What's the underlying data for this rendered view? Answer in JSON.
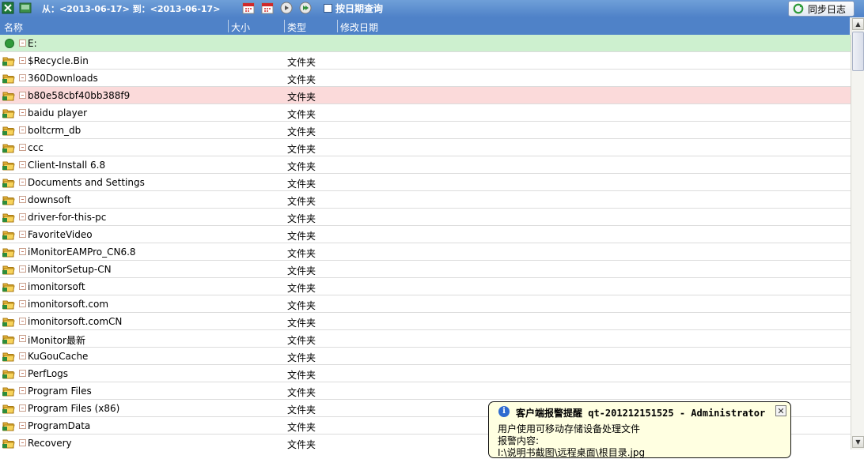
{
  "toolbar": {
    "date_range_text": "从：<2013-06-17> 到：<2013-06-17>",
    "date_query_label": "按日期查询",
    "sync_log_label": "同步日志"
  },
  "columns": [
    "名称",
    "大小",
    "类型",
    "修改日期"
  ],
  "drive": {
    "label": "E:"
  },
  "rows": [
    {
      "name": "$Recycle.Bin",
      "type": "文件夹"
    },
    {
      "name": "360Downloads",
      "type": "文件夹"
    },
    {
      "name": "b80e58cbf40bb388f9",
      "type": "文件夹"
    },
    {
      "name": "baidu player",
      "type": "文件夹"
    },
    {
      "name": "boltcrm_db",
      "type": "文件夹"
    },
    {
      "name": "ccc",
      "type": "文件夹"
    },
    {
      "name": "Client-Install 6.8",
      "type": "文件夹"
    },
    {
      "name": "Documents and Settings",
      "type": "文件夹"
    },
    {
      "name": "downsoft",
      "type": "文件夹"
    },
    {
      "name": "driver-for-this-pc",
      "type": "文件夹"
    },
    {
      "name": "FavoriteVideo",
      "type": "文件夹"
    },
    {
      "name": "iMonitorEAMPro_CN6.8",
      "type": "文件夹"
    },
    {
      "name": "iMonitorSetup-CN",
      "type": "文件夹"
    },
    {
      "name": "imonitorsoft",
      "type": "文件夹"
    },
    {
      "name": "imonitorsoft.com",
      "type": "文件夹"
    },
    {
      "name": "imonitorsoft.comCN",
      "type": "文件夹"
    },
    {
      "name": "iMonitor最新",
      "type": "文件夹"
    },
    {
      "name": "KuGouCache",
      "type": "文件夹"
    },
    {
      "name": "PerfLogs",
      "type": "文件夹"
    },
    {
      "name": "Program Files",
      "type": "文件夹"
    },
    {
      "name": "Program Files (x86)",
      "type": "文件夹"
    },
    {
      "name": "ProgramData",
      "type": "文件夹"
    },
    {
      "name": "Recovery",
      "type": "文件夹"
    }
  ],
  "alert": {
    "title": "客户端报警提醒 qt-201212151525 - Administrator",
    "line1": "用户使用可移动存储设备处理文件",
    "line2": "报警内容:",
    "line3": "I:\\说明书截图\\远程桌面\\根目录.jpg"
  },
  "colors": {
    "toolbar_bg": "#4f82c8",
    "drive_row": "#cdf0cf",
    "highlight_row": "#fbdada",
    "alert_bg": "#ffffe1"
  }
}
